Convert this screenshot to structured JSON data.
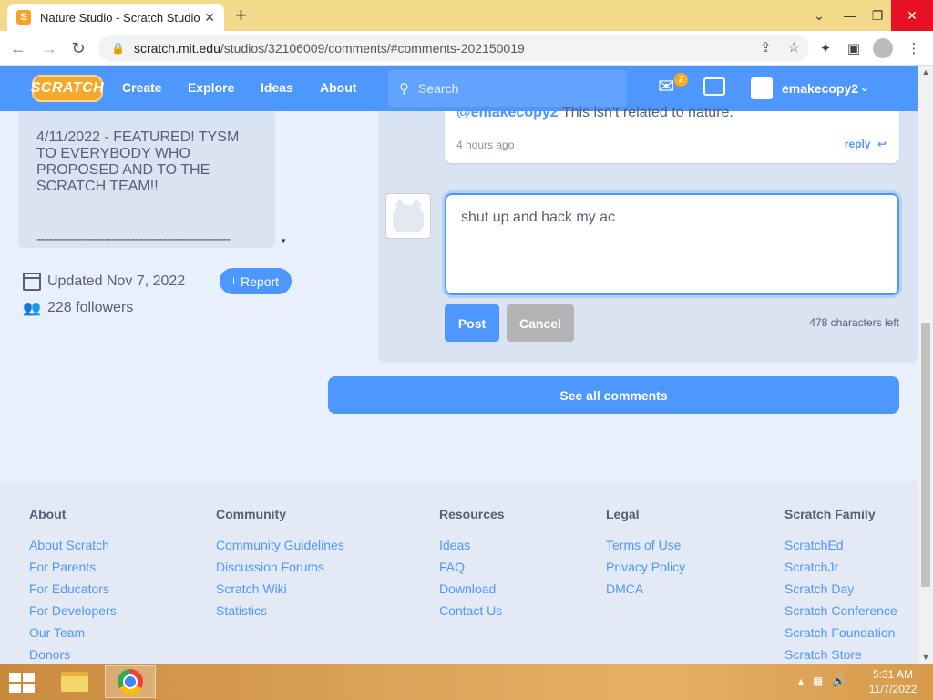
{
  "browser": {
    "tab_title": "Nature Studio - Scratch Studio",
    "tab_favicon": "S",
    "url_domain": "scratch.mit.edu",
    "url_path": "/studios/32106009/comments/#comments-202150019"
  },
  "nav": {
    "logo": "SCRATCH",
    "links": [
      "Create",
      "Explore",
      "Ideas",
      "About"
    ],
    "search_placeholder": "Search",
    "messages_count": "2",
    "username": "emakecopy2"
  },
  "studio": {
    "description_text": "4/11/2022 - FEATURED! TYSM TO EVERYBODY WHO PROPOSED AND TO THE SCRATCH TEAM!!",
    "description_divider": "-------------------------------------------------",
    "updated": "Updated Nov 7, 2022",
    "followers": "228 followers",
    "report_label": "Report"
  },
  "comments": {
    "prev_mention": "@emakecopy2",
    "prev_text": "This isn't related to nature.",
    "prev_time": "4 hours ago",
    "reply_label": "reply",
    "draft_text": "shut up and hack my ac",
    "post_label": "Post",
    "cancel_label": "Cancel",
    "chars_left": "478 characters left",
    "see_all_label": "See all comments"
  },
  "footer": {
    "columns": [
      {
        "heading": "About",
        "links": [
          "About Scratch",
          "For Parents",
          "For Educators",
          "For Developers",
          "Our Team",
          "Donors"
        ]
      },
      {
        "heading": "Community",
        "links": [
          "Community Guidelines",
          "Discussion Forums",
          "Scratch Wiki",
          "Statistics"
        ]
      },
      {
        "heading": "Resources",
        "links": [
          "Ideas",
          "FAQ",
          "Download",
          "Contact Us"
        ]
      },
      {
        "heading": "Legal",
        "links": [
          "Terms of Use",
          "Privacy Policy",
          "DMCA"
        ]
      },
      {
        "heading": "Scratch Family",
        "links": [
          "ScratchEd",
          "ScratchJr",
          "Scratch Day",
          "Scratch Conference",
          "Scratch Foundation",
          "Scratch Store"
        ]
      }
    ]
  },
  "taskbar": {
    "time": "5:31 AM",
    "date": "11/7/2022"
  },
  "colors": {
    "scratch_blue": "#4d97ff",
    "tabbar": "#f3d98a",
    "page_bg": "#e8f0fb"
  }
}
